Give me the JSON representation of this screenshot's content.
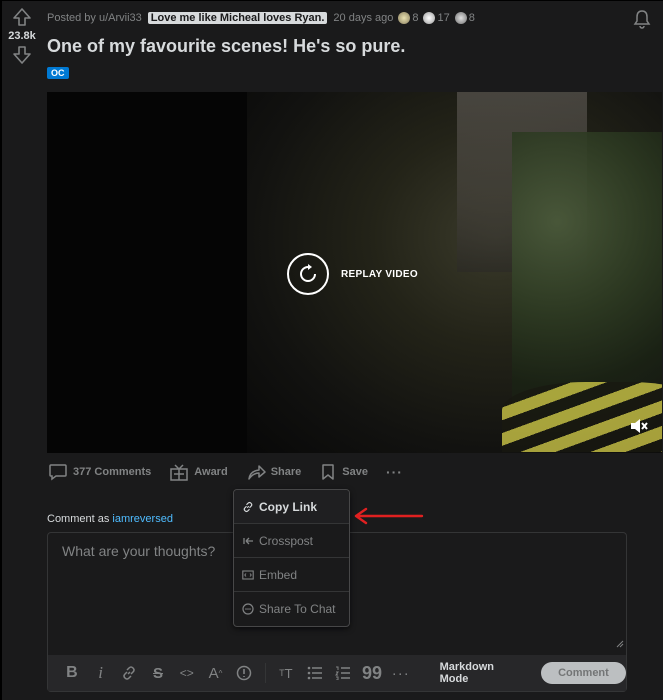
{
  "post": {
    "score": "23.8k",
    "posted_by": "Posted by u/Arvii33",
    "user_flair": "Love me like Micheal loves Ryan.",
    "age": "20 days ago",
    "awards": [
      {
        "icon": "wholesome-award-icon",
        "count": "8",
        "color": "#c9c9a0"
      },
      {
        "icon": "helpful-award-icon",
        "count": "17",
        "color": "#e0e0e0"
      },
      {
        "icon": "silver-award-icon",
        "count": "8",
        "color": "#c0c0c0"
      }
    ],
    "title": "One of my favourite scenes! He's so pure.",
    "flair": "OC"
  },
  "video": {
    "replay_label": "REPLAY VIDEO"
  },
  "actions": {
    "comments": "377 Comments",
    "award": "Award",
    "share": "Share",
    "save": "Save",
    "more": "···"
  },
  "share_menu": {
    "items": [
      {
        "label": "Copy Link",
        "icon": "link-icon"
      },
      {
        "label": "Crosspost",
        "icon": "crosspost-icon"
      },
      {
        "label": "Embed",
        "icon": "embed-icon"
      },
      {
        "label": "Share To Chat",
        "icon": "chat-icon"
      }
    ]
  },
  "comment": {
    "as_prefix": "Comment as",
    "username": "iamreversed",
    "placeholder": "What are your thoughts?",
    "markdown_mode": "Markdown Mode",
    "submit": "Comment"
  },
  "colors": {
    "background": "#1a1a1b",
    "accent": "#0079d3",
    "link": "#4fbcff",
    "annotation_arrow": "#e02020"
  }
}
